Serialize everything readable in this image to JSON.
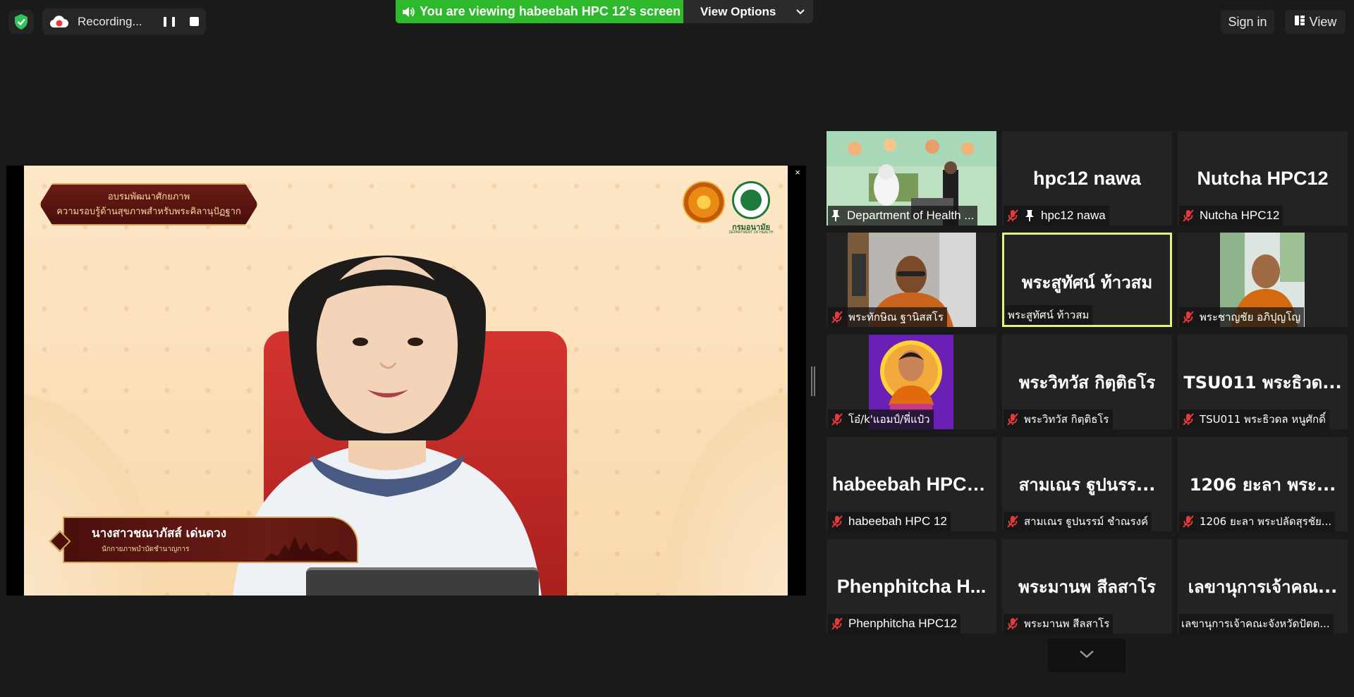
{
  "top_bar": {
    "recording_label": "Recording...",
    "sharing_banner": "You are viewing habeebah HPC 12's screen",
    "view_options_label": "View Options",
    "sign_in_label": "Sign in",
    "view_label": "View"
  },
  "shared_screen": {
    "banner_line1": "อบรมพัฒนาศักยภาพ",
    "banner_line2": "ความรอบรู้ด้านสุขภาพสำหรับพระคิลานุปัฏฐาก",
    "logo_text": "กรมอนามัย",
    "logo_subtext": "DEPARTMENT OF HEALTH",
    "speaker_name": "นางสาวชณาภัสส์ เด่นดวง",
    "speaker_title": "นักกายภาพบำบัดชำนาญการ",
    "close_symbol": "×"
  },
  "gallery": [
    {
      "display": "",
      "name": "Department of Health ...",
      "muted": false,
      "pinned": true,
      "video": "classroom"
    },
    {
      "display": "hpc12 nawa",
      "name": "hpc12 nawa",
      "muted": true,
      "pinned": true
    },
    {
      "display": "Nutcha HPC12",
      "name": "Nutcha HPC12",
      "muted": true,
      "pinned": false
    },
    {
      "display": "",
      "name": "พระทักษิณ ฐานิสสโร",
      "muted": true,
      "pinned": false,
      "video": "monk-room"
    },
    {
      "display": "พระสูทัศน์  ท้าวสม",
      "name": "พระสูทัศน์ ท้าวสม",
      "muted": false,
      "pinned": false,
      "active": true
    },
    {
      "display": "",
      "name": "พระชาญชัย อภิปุญโญ",
      "muted": true,
      "pinned": false,
      "video": "monk-outdoor"
    },
    {
      "display": "",
      "name": "โอ๋/k'แอมป์/พี่แป๋ว",
      "muted": true,
      "pinned": false,
      "video": "purple-portrait"
    },
    {
      "display": "พระวิทวัส กิตฺติธโร",
      "name": "พระวิทวัส กิตฺติธโร",
      "muted": true,
      "pinned": false
    },
    {
      "display": "TSU011 พระธิวด...",
      "name": "TSU011 พระธิวดล หนูศักดิ์",
      "muted": true,
      "pinned": false
    },
    {
      "display": "habeebah HPC 12",
      "name": "habeebah HPC 12",
      "muted": true,
      "pinned": false
    },
    {
      "display": "สามเณร ฐูปนรร...",
      "name": "สามเณร ฐูปนรรม์ ชำณรงค์",
      "muted": true,
      "pinned": false
    },
    {
      "display": "1206 ยะลา  พระ...",
      "name": "1206 ยะลา  พระปลัดสุรชัย...",
      "muted": true,
      "pinned": false
    },
    {
      "display": "Phenphitcha  H...",
      "name": "Phenphitcha HPC12",
      "muted": true,
      "pinned": false
    },
    {
      "display": "พระมานพ สีลสาโร",
      "name": "พระมานพ สีลสาโร",
      "muted": true,
      "pinned": false
    },
    {
      "display": "เลขานุการเจ้าคณ...",
      "name": "เลขานุการเจ้าคณะจังหวัดปัตต...",
      "muted": false,
      "pinned": false
    }
  ],
  "colors": {
    "background": "#1a1a1a",
    "sharing_green": "#2db92b",
    "active_speaker_border": "#e4f27c",
    "muted_red": "#e5393b",
    "record_red": "#e5393b"
  }
}
